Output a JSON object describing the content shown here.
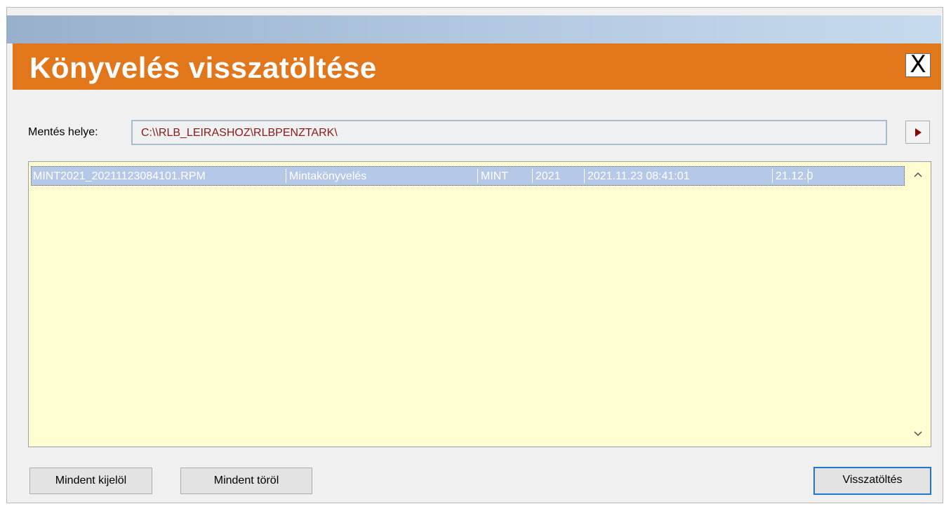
{
  "dialog": {
    "title": "Könyvelés visszatöltése",
    "close_label": "X"
  },
  "save_location": {
    "label": "Mentés helye:",
    "value": "C:\\\\RLB_LEIRASHOZ\\RLBPENZTARK\\"
  },
  "list": {
    "rows": [
      {
        "file": "MINT2021_20211123084101.RPM",
        "name": "Mintakönyvelés",
        "code": "MINT",
        "year": "2021",
        "datetime": "2021.11.23 08:41:01",
        "version": "21.12.0"
      }
    ]
  },
  "buttons": {
    "select_all": "Mindent kijelöl",
    "clear_all": "Mindent töröl",
    "restore": "Visszatöltés"
  },
  "colors": {
    "title_bar": "#e2761b",
    "list_background": "#fffdd1",
    "selected_row": "#b5c8e8",
    "path_text": "#8b1a1a"
  },
  "icons": {
    "close": "close-icon",
    "browse": "play-arrow-icon",
    "scroll_up": "chevron-up-icon",
    "scroll_down": "chevron-down-icon"
  }
}
